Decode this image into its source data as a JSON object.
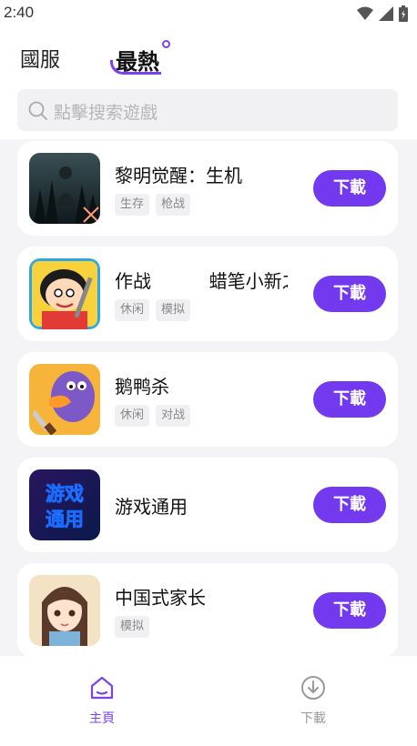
{
  "status_bar": {
    "time": "2:40"
  },
  "top_tabs": {
    "tab1": "國服",
    "tab2": "最熱"
  },
  "search": {
    "placeholder": "點擊搜索遊戲"
  },
  "games": [
    {
      "title": "黎明觉醒：生机",
      "tags": [
        "生存",
        "枪战"
      ],
      "button": "下載",
      "thumb": "dark-forest"
    },
    {
      "title": "作战          蜡笔小新之",
      "tags": [
        "休闲",
        "模拟"
      ],
      "button": "下載",
      "thumb": "crayon-boy"
    },
    {
      "title": "鹅鸭杀",
      "tags": [
        "休闲",
        "对战"
      ],
      "button": "下載",
      "thumb": "purple-goose"
    },
    {
      "title": "游戏通用",
      "tags": [],
      "button": "下載",
      "thumb": "neon-text",
      "thumb_text": [
        "游戏",
        "通用"
      ]
    },
    {
      "title": "中国式家长",
      "tags": [
        "模拟"
      ],
      "button": "下載",
      "thumb": "anime-girl"
    }
  ],
  "bottom_nav": {
    "home_label": "主頁",
    "download_label": "下載"
  },
  "colors": {
    "accent": "#7339ee",
    "background": "#f4f4f6"
  }
}
